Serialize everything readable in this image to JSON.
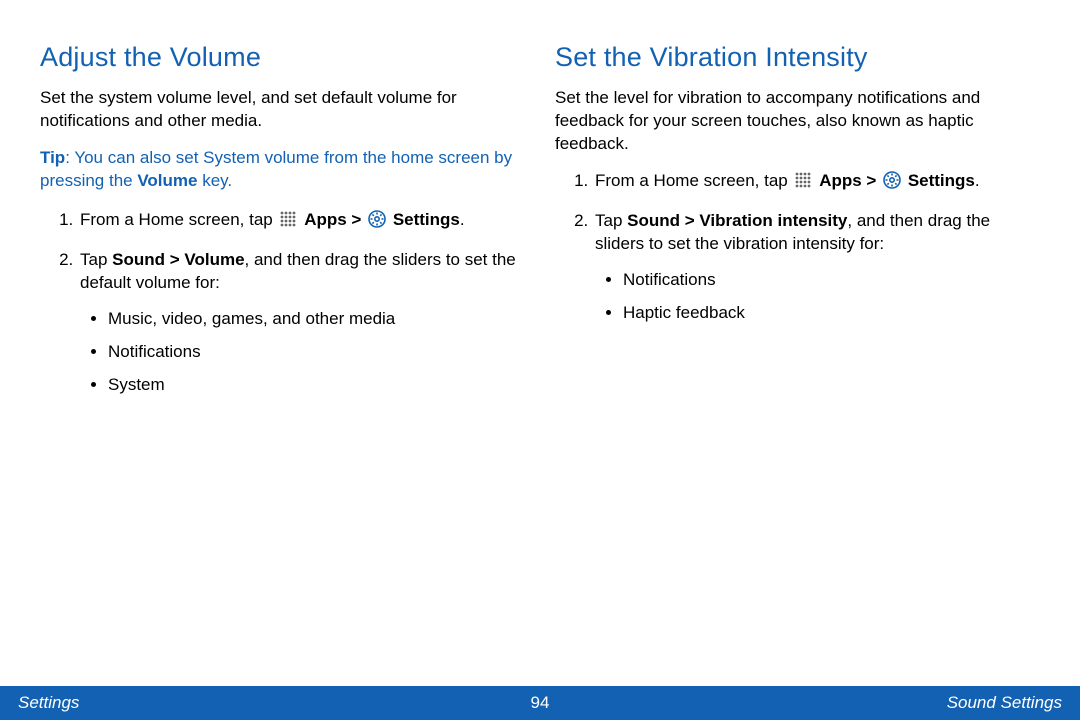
{
  "left": {
    "heading": "Adjust the Volume",
    "intro": "Set the system volume level, and set default volume for notifications and other media.",
    "tip_label": "Tip",
    "tip_before": ": You can also set System volume from the home screen by pressing the ",
    "tip_bold": "Volume",
    "tip_after": " key.",
    "step1_before": "From a Home screen, tap ",
    "step1_apps": "Apps > ",
    "step1_settings": "Settings",
    "step1_after": ".",
    "step2_before": "Tap ",
    "step2_bold": "Sound > Volume",
    "step2_after": ", and then drag the sliders to set the default volume for:",
    "bullets": {
      "b1": "Music, video, games, and other media",
      "b2": "Notifications",
      "b3": "System"
    }
  },
  "right": {
    "heading": "Set the Vibration Intensity",
    "intro": "Set the level for vibration to accompany notifications and feedback for your screen touches, also known as haptic feedback.",
    "step1_before": "From a Home screen, tap ",
    "step1_apps": "Apps > ",
    "step1_settings": "Settings",
    "step1_after": ".",
    "step2_before": "Tap ",
    "step2_bold": "Sound > Vibration intensity",
    "step2_after": ", and then drag the sliders to set the vibration intensity for:",
    "bullets": {
      "b1": "Notifications",
      "b2": "Haptic feedback"
    }
  },
  "footer": {
    "left": "Settings",
    "page": "94",
    "right": "Sound Settings"
  }
}
